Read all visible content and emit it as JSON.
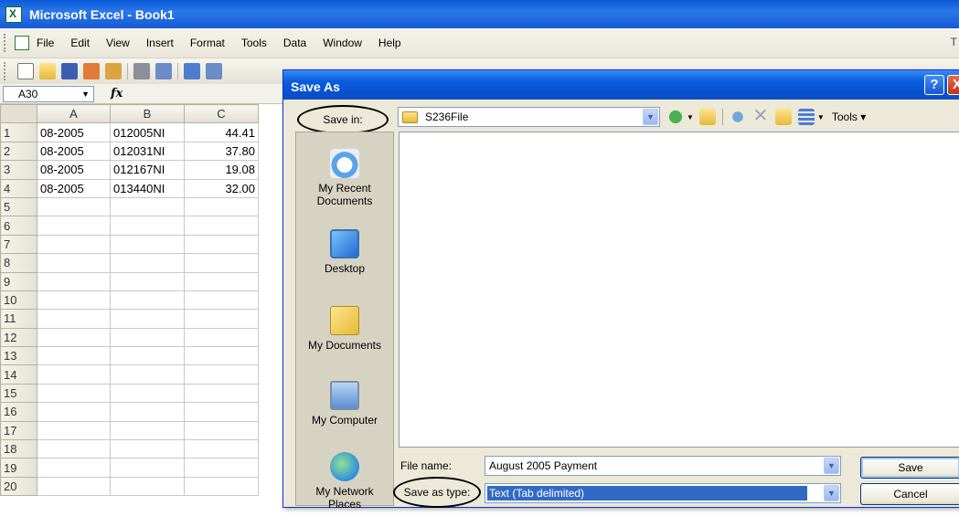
{
  "excel": {
    "title": "Microsoft Excel - Book1",
    "menus": [
      "File",
      "Edit",
      "View",
      "Insert",
      "Format",
      "Tools",
      "Data",
      "Window",
      "Help"
    ],
    "menubar_right": "T",
    "name_box": "A30",
    "fx_symbol": "fx",
    "columns": [
      "A",
      "B",
      "C"
    ],
    "rows": [
      {
        "n": "1",
        "a": "08-2005",
        "b": "012005NI",
        "c": "44.41"
      },
      {
        "n": "2",
        "a": "08-2005",
        "b": "012031NI",
        "c": "37.80"
      },
      {
        "n": "3",
        "a": "08-2005",
        "b": "012167NI",
        "c": "19.08"
      },
      {
        "n": "4",
        "a": "08-2005",
        "b": "013440NI",
        "c": "32.00"
      },
      {
        "n": "5",
        "a": "",
        "b": "",
        "c": ""
      },
      {
        "n": "6",
        "a": "",
        "b": "",
        "c": ""
      },
      {
        "n": "7",
        "a": "",
        "b": "",
        "c": ""
      },
      {
        "n": "8",
        "a": "",
        "b": "",
        "c": ""
      },
      {
        "n": "9",
        "a": "",
        "b": "",
        "c": ""
      },
      {
        "n": "10",
        "a": "",
        "b": "",
        "c": ""
      },
      {
        "n": "11",
        "a": "",
        "b": "",
        "c": ""
      },
      {
        "n": "12",
        "a": "",
        "b": "",
        "c": ""
      },
      {
        "n": "13",
        "a": "",
        "b": "",
        "c": ""
      },
      {
        "n": "14",
        "a": "",
        "b": "",
        "c": ""
      },
      {
        "n": "15",
        "a": "",
        "b": "",
        "c": ""
      },
      {
        "n": "16",
        "a": "",
        "b": "",
        "c": ""
      },
      {
        "n": "17",
        "a": "",
        "b": "",
        "c": ""
      },
      {
        "n": "18",
        "a": "",
        "b": "",
        "c": ""
      },
      {
        "n": "19",
        "a": "",
        "b": "",
        "c": ""
      },
      {
        "n": "20",
        "a": "",
        "b": "",
        "c": ""
      }
    ]
  },
  "dialog": {
    "title": "Save As",
    "help": "?",
    "close": "X",
    "save_in_label": "Save in:",
    "save_in_value": "S236File",
    "tools_label": "Tools",
    "places": [
      "My Recent Documents",
      "Desktop",
      "My Documents",
      "My Computer",
      "My Network Places"
    ],
    "file_name_label": "File name:",
    "file_name_value": "August 2005 Payment",
    "save_as_type_label": "Save as type:",
    "save_as_type_value": "Text (Tab delimited)",
    "save_button": "Save",
    "cancel_button": "Cancel"
  },
  "colors": {
    "titlebar": "#0a5ad9",
    "dialog_bg": "#ece9d8",
    "selection": "#316ac5"
  }
}
